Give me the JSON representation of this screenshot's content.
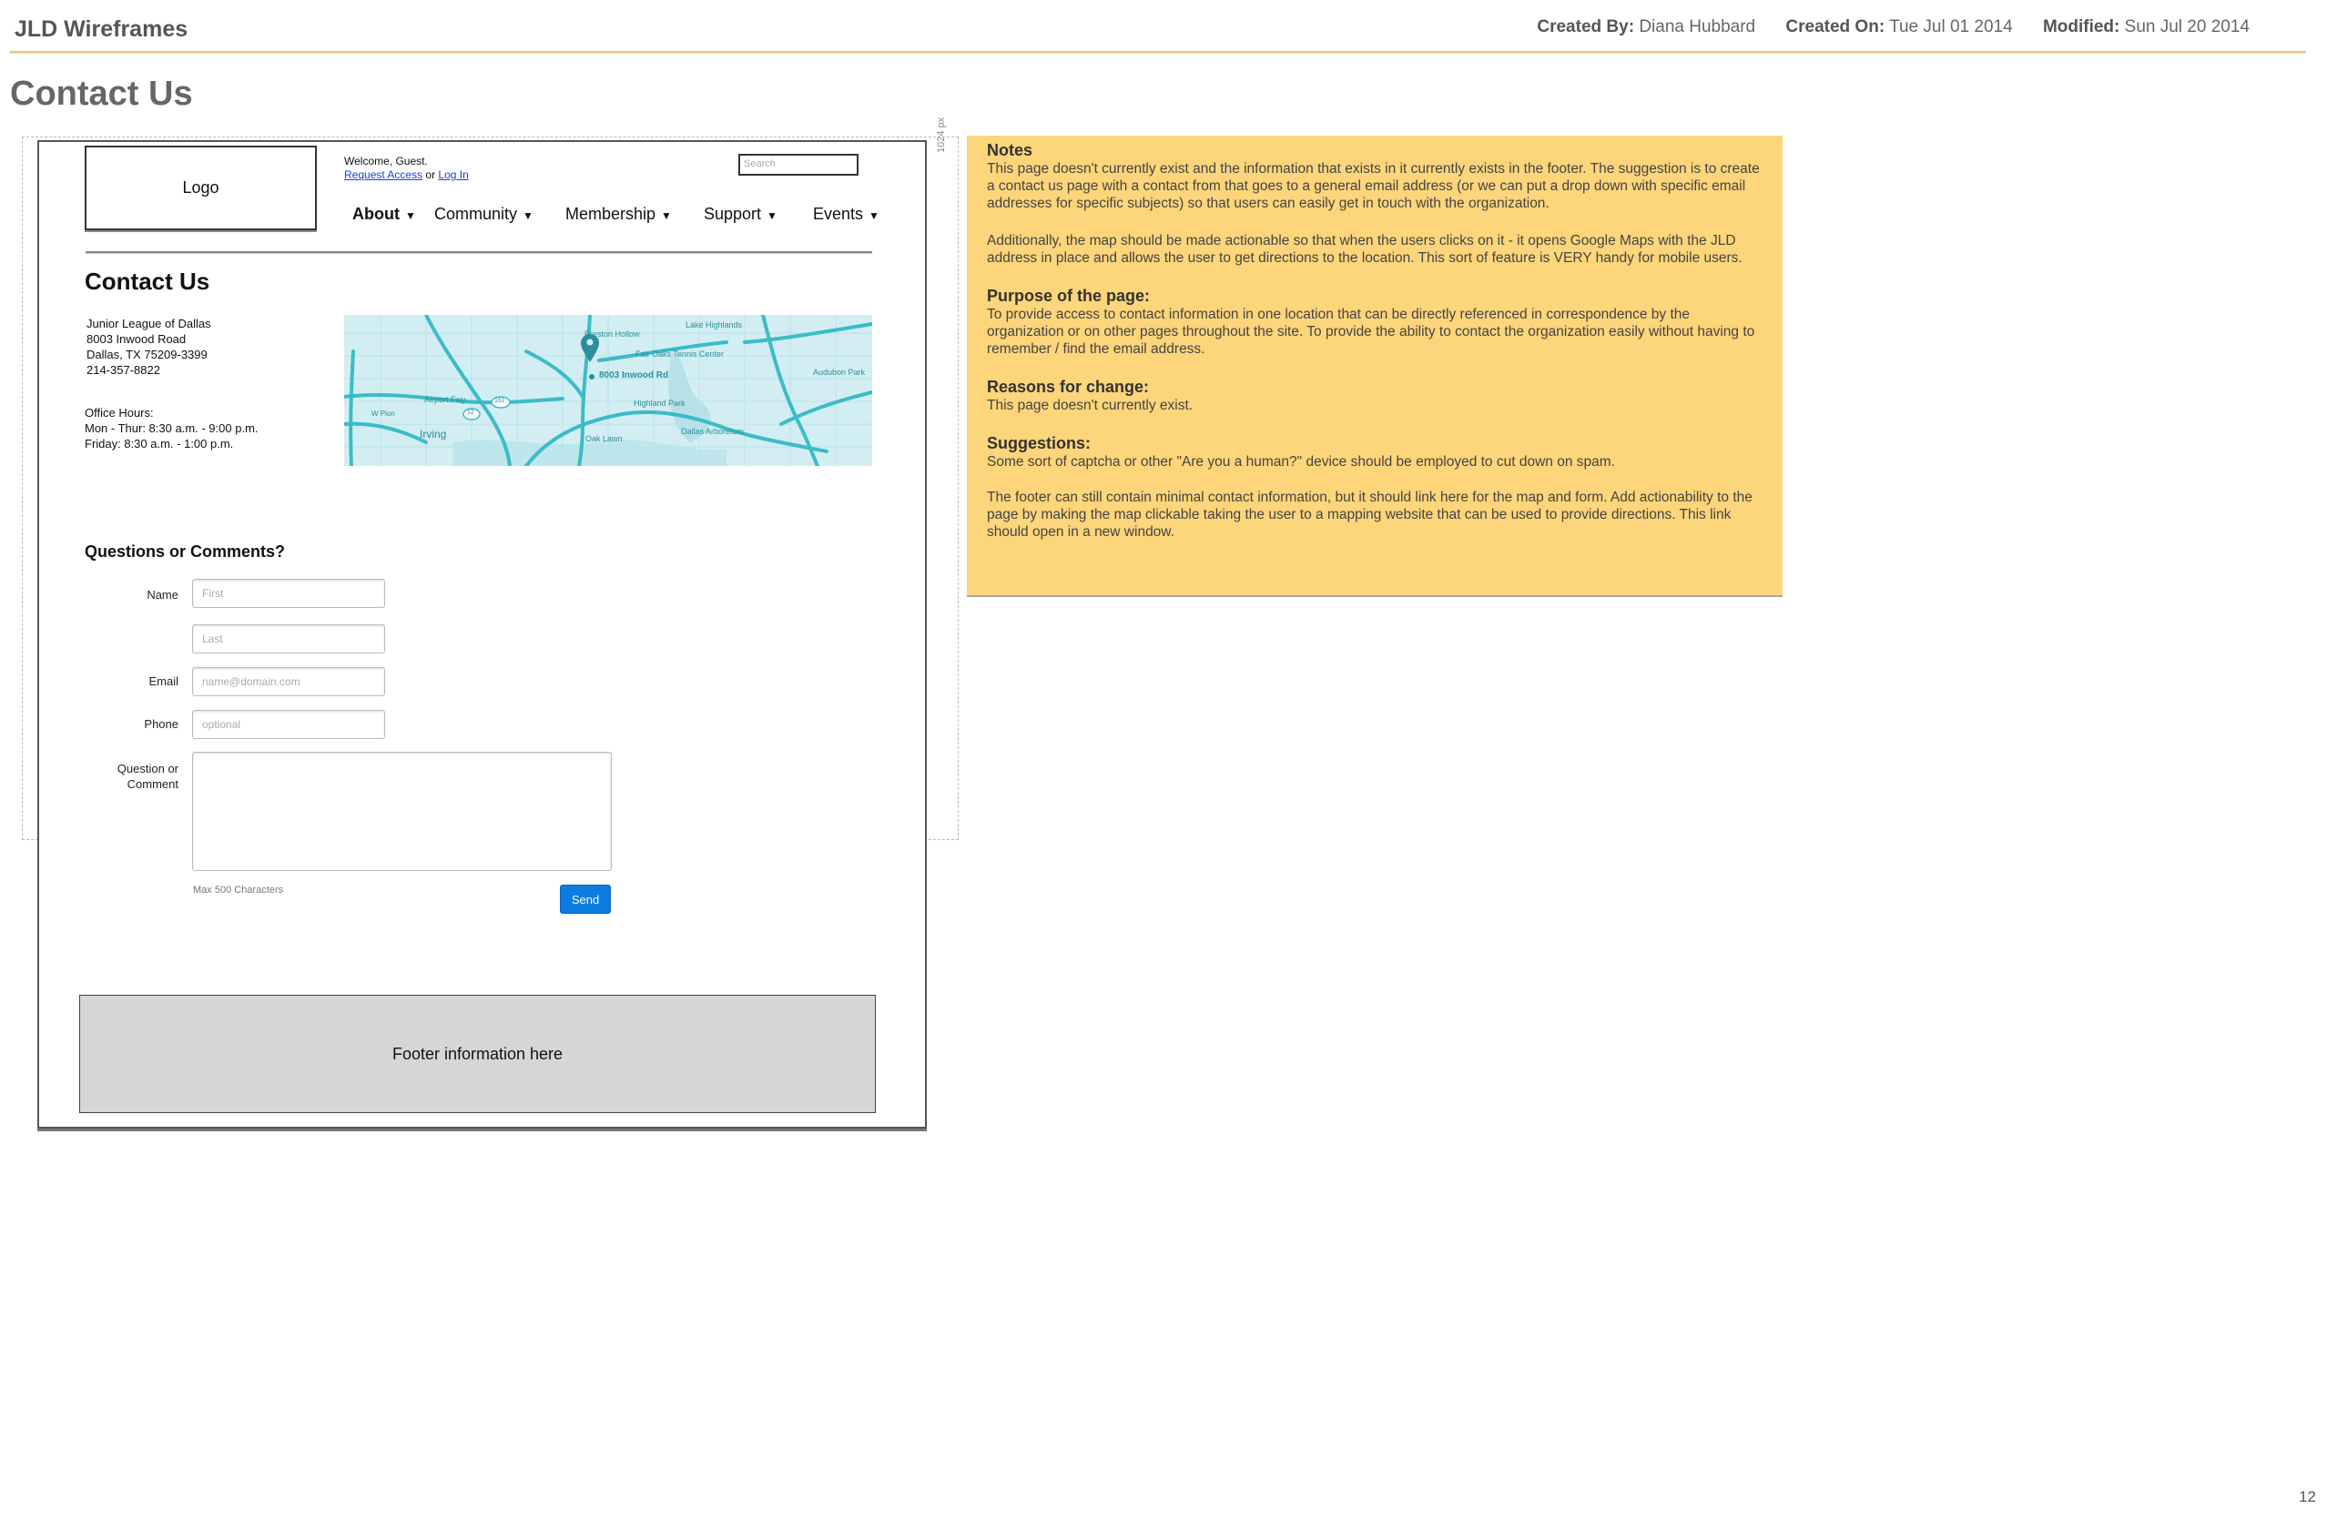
{
  "document": {
    "title": "JLD Wireframes",
    "created_by_label": "Created By:",
    "created_by": "Diana Hubbard",
    "created_on_label": "Created On:",
    "created_on": "Tue Jul 01 2014",
    "modified_label": "Modified:",
    "modified": "Sun Jul 20 2014",
    "page_heading": "Contact Us",
    "page_number": "12"
  },
  "guide": {
    "width_label": "1024 px"
  },
  "site": {
    "logo": "Logo",
    "welcome": "Welcome, Guest.",
    "request_access": "Request Access",
    "or": "or",
    "log_in": "Log In",
    "search_placeholder": "Search",
    "nav": [
      {
        "label": "About"
      },
      {
        "label": "Community"
      },
      {
        "label": "Membership"
      },
      {
        "label": "Support"
      },
      {
        "label": "Events"
      }
    ],
    "nav_caret": "▼"
  },
  "contact": {
    "title": "Contact Us",
    "address": [
      "Junior League of Dallas",
      "8003 Inwood Road",
      "Dallas, TX 75209-3399",
      "214-357-8822"
    ],
    "hours_title": "Office Hours:",
    "hours": [
      "Mon - Thur: 8:30 a.m. - 9:00 p.m.",
      "Friday:  8:30 a.m. - 1:00 p.m."
    ]
  },
  "map": {
    "labels": {
      "pin": "8003 Inwood Rd",
      "lake_highlands": "Lake Highlands",
      "preston_hollow": "Preston Hollow",
      "fair_oaks": "Fair Oaks Tennis Center",
      "audubon": "Audubon Park",
      "highland_park": "Highland Park",
      "airport_fwy": "Airport Fwy",
      "irving": "Irving",
      "oak_lawn": "Oak Lawn",
      "dallas_arboretum": "Dallas Arboretum",
      "w_pioneer": "W Pion",
      "hwy_161": "161",
      "hwy_12": "12"
    },
    "colors": {
      "land": "#d3eef2",
      "road": "#3bbcc8",
      "water": "#b6e1e8",
      "text": "#2a8f9b"
    }
  },
  "form": {
    "title": "Questions or Comments?",
    "name_label": "Name",
    "first_placeholder": "First",
    "last_placeholder": "Last",
    "email_label": "Email",
    "email_placeholder": "name@domain.com",
    "phone_label": "Phone",
    "phone_placeholder": "optional",
    "question_label_1": "Question or",
    "question_label_2": "Comment",
    "max_chars": "Max 500 Characters",
    "send": "Send",
    "send_color": "#0d7ce0"
  },
  "footer": {
    "text": "Footer information here"
  },
  "notes": {
    "heading": "Notes",
    "p1": "This page doesn't currently exist and the information that exists in it currently exists in the footer. The suggestion is to create a contact us page with a contact from that goes to a general email address (or we can put a drop down with specific email addresses for specific subjects) so that users can easily get in touch with the organization.",
    "p2": "Additionally, the map should be made actionable so that when the users clicks on it - it opens Google Maps with the JLD address in place and allows the user to get directions to the location. This sort of feature is VERY handy for mobile users.",
    "purpose_heading": "Purpose of the page:",
    "purpose": "To provide access to contact information in one location that can be directly referenced in correspondence by the organization or on other pages throughout the site. To provide the ability to contact the organization easily without having to remember / find the email address.",
    "reasons_heading": "Reasons for change:",
    "reasons": "This page doesn't currently exist.",
    "suggestions_heading": "Suggestions:",
    "s1": "Some sort of captcha or other \"Are you a human?\" device should be employed to cut down on spam.",
    "s2": "The footer can still contain minimal contact information, but it should link here for the map and form. Add actionability to the page by making the map clickable taking the user to a mapping website that can be used to provide directions. This link should open in a new window.",
    "background_color": "#fdd57a"
  }
}
